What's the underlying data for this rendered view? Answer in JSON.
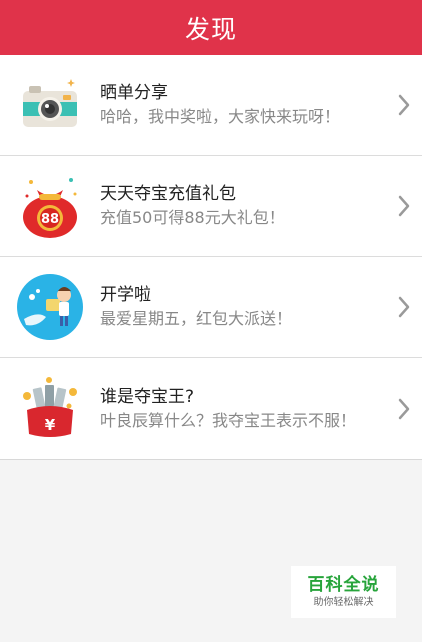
{
  "header": {
    "title": "发现"
  },
  "items": [
    {
      "title": "晒单分享",
      "subtitle": "哈哈，我中奖啦，大家快来玩呀！",
      "icon": "camera-icon"
    },
    {
      "title": "天天夺宝充值礼包",
      "subtitle": "充值50可得88元大礼包！",
      "icon": "lucky-bag-88-icon"
    },
    {
      "title": "开学啦",
      "subtitle": "最爱星期五，红包大派送！",
      "icon": "school-kid-icon"
    },
    {
      "title": "谁是夺宝王?",
      "subtitle": "叶良辰算什么？我夺宝王表示不服！",
      "icon": "money-bag-yen-icon"
    }
  ],
  "watermark": {
    "title": "百科全说",
    "subtitle": "助你轻松解决"
  },
  "colors": {
    "header": "#e0334a",
    "watermark": "#27a43b"
  }
}
